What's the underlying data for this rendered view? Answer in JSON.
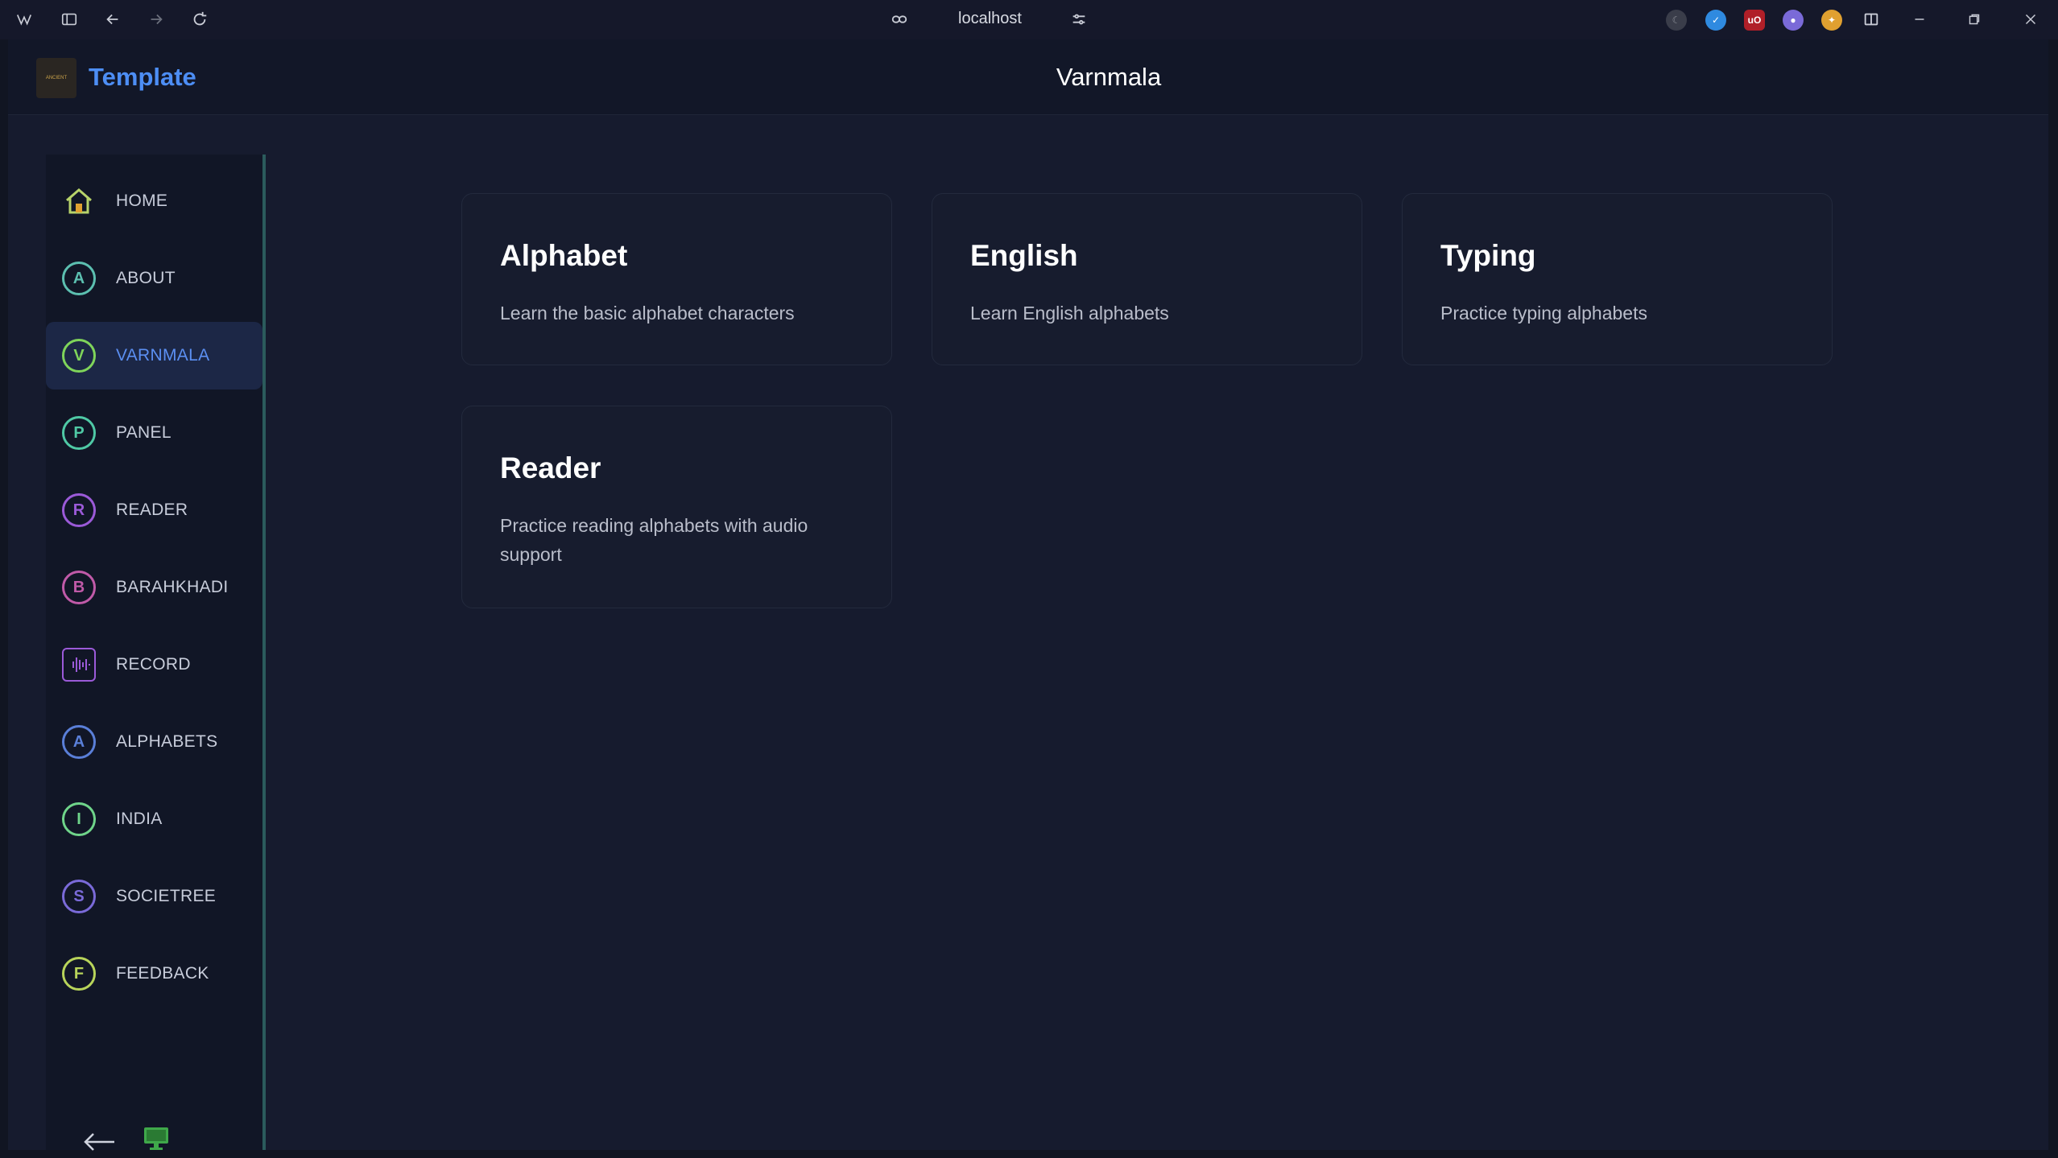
{
  "browser": {
    "url": "localhost"
  },
  "header": {
    "logo_text": "ANCIENT",
    "brand": "Template",
    "title": "Varnmala"
  },
  "sidebar": {
    "items": [
      {
        "label": "HOME",
        "letter": "",
        "color": "#b7d36a",
        "icon": "home-icon"
      },
      {
        "label": "ABOUT",
        "letter": "A",
        "color": "#5cbfb0"
      },
      {
        "label": "VARNMALA",
        "letter": "V",
        "color": "#7fd45a",
        "active": true
      },
      {
        "label": "PANEL",
        "letter": "P",
        "color": "#4fc9a5"
      },
      {
        "label": "READER",
        "letter": "R",
        "color": "#9b5ad8"
      },
      {
        "label": "BARAHKHADI",
        "letter": "B",
        "color": "#c05aa8"
      },
      {
        "label": "RECORD",
        "letter": "",
        "color": "#9b5ad8",
        "icon": "waveform-icon"
      },
      {
        "label": "ALPHABETS",
        "letter": "A",
        "color": "#5a7fd8"
      },
      {
        "label": "INDIA",
        "letter": "I",
        "color": "#6fd48a"
      },
      {
        "label": "SOCIETREE",
        "letter": "S",
        "color": "#7a6ad8"
      },
      {
        "label": "FEEDBACK",
        "letter": "F",
        "color": "#b8d45a"
      }
    ]
  },
  "cards": [
    {
      "title": "Alphabet",
      "desc": "Learn the basic alphabet characters"
    },
    {
      "title": "English",
      "desc": "Learn English alphabets"
    },
    {
      "title": "Typing",
      "desc": "Practice typing alphabets"
    },
    {
      "title": "Reader",
      "desc": "Practice reading alphabets with audio support"
    }
  ],
  "colors": {
    "accent": "#4d8ef5",
    "background": "#161b2e",
    "sidebar": "#111626"
  }
}
